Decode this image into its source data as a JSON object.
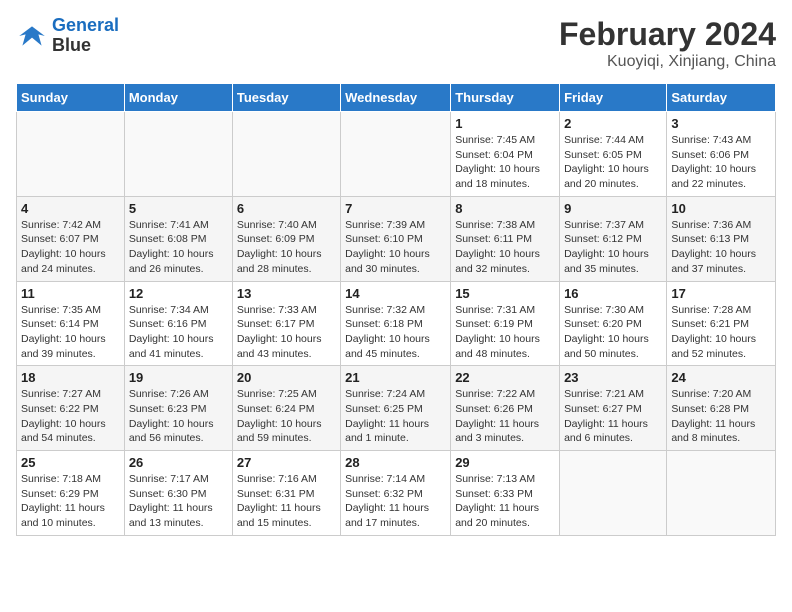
{
  "app": {
    "logo_line1": "General",
    "logo_line2": "Blue"
  },
  "title": "February 2024",
  "subtitle": "Kuoyiqi, Xinjiang, China",
  "weekdays": [
    "Sunday",
    "Monday",
    "Tuesday",
    "Wednesday",
    "Thursday",
    "Friday",
    "Saturday"
  ],
  "weeks": [
    [
      {
        "day": "",
        "info": ""
      },
      {
        "day": "",
        "info": ""
      },
      {
        "day": "",
        "info": ""
      },
      {
        "day": "",
        "info": ""
      },
      {
        "day": "1",
        "info": "Sunrise: 7:45 AM\nSunset: 6:04 PM\nDaylight: 10 hours\nand 18 minutes."
      },
      {
        "day": "2",
        "info": "Sunrise: 7:44 AM\nSunset: 6:05 PM\nDaylight: 10 hours\nand 20 minutes."
      },
      {
        "day": "3",
        "info": "Sunrise: 7:43 AM\nSunset: 6:06 PM\nDaylight: 10 hours\nand 22 minutes."
      }
    ],
    [
      {
        "day": "4",
        "info": "Sunrise: 7:42 AM\nSunset: 6:07 PM\nDaylight: 10 hours\nand 24 minutes."
      },
      {
        "day": "5",
        "info": "Sunrise: 7:41 AM\nSunset: 6:08 PM\nDaylight: 10 hours\nand 26 minutes."
      },
      {
        "day": "6",
        "info": "Sunrise: 7:40 AM\nSunset: 6:09 PM\nDaylight: 10 hours\nand 28 minutes."
      },
      {
        "day": "7",
        "info": "Sunrise: 7:39 AM\nSunset: 6:10 PM\nDaylight: 10 hours\nand 30 minutes."
      },
      {
        "day": "8",
        "info": "Sunrise: 7:38 AM\nSunset: 6:11 PM\nDaylight: 10 hours\nand 32 minutes."
      },
      {
        "day": "9",
        "info": "Sunrise: 7:37 AM\nSunset: 6:12 PM\nDaylight: 10 hours\nand 35 minutes."
      },
      {
        "day": "10",
        "info": "Sunrise: 7:36 AM\nSunset: 6:13 PM\nDaylight: 10 hours\nand 37 minutes."
      }
    ],
    [
      {
        "day": "11",
        "info": "Sunrise: 7:35 AM\nSunset: 6:14 PM\nDaylight: 10 hours\nand 39 minutes."
      },
      {
        "day": "12",
        "info": "Sunrise: 7:34 AM\nSunset: 6:16 PM\nDaylight: 10 hours\nand 41 minutes."
      },
      {
        "day": "13",
        "info": "Sunrise: 7:33 AM\nSunset: 6:17 PM\nDaylight: 10 hours\nand 43 minutes."
      },
      {
        "day": "14",
        "info": "Sunrise: 7:32 AM\nSunset: 6:18 PM\nDaylight: 10 hours\nand 45 minutes."
      },
      {
        "day": "15",
        "info": "Sunrise: 7:31 AM\nSunset: 6:19 PM\nDaylight: 10 hours\nand 48 minutes."
      },
      {
        "day": "16",
        "info": "Sunrise: 7:30 AM\nSunset: 6:20 PM\nDaylight: 10 hours\nand 50 minutes."
      },
      {
        "day": "17",
        "info": "Sunrise: 7:28 AM\nSunset: 6:21 PM\nDaylight: 10 hours\nand 52 minutes."
      }
    ],
    [
      {
        "day": "18",
        "info": "Sunrise: 7:27 AM\nSunset: 6:22 PM\nDaylight: 10 hours\nand 54 minutes."
      },
      {
        "day": "19",
        "info": "Sunrise: 7:26 AM\nSunset: 6:23 PM\nDaylight: 10 hours\nand 56 minutes."
      },
      {
        "day": "20",
        "info": "Sunrise: 7:25 AM\nSunset: 6:24 PM\nDaylight: 10 hours\nand 59 minutes."
      },
      {
        "day": "21",
        "info": "Sunrise: 7:24 AM\nSunset: 6:25 PM\nDaylight: 11 hours\nand 1 minute."
      },
      {
        "day": "22",
        "info": "Sunrise: 7:22 AM\nSunset: 6:26 PM\nDaylight: 11 hours\nand 3 minutes."
      },
      {
        "day": "23",
        "info": "Sunrise: 7:21 AM\nSunset: 6:27 PM\nDaylight: 11 hours\nand 6 minutes."
      },
      {
        "day": "24",
        "info": "Sunrise: 7:20 AM\nSunset: 6:28 PM\nDaylight: 11 hours\nand 8 minutes."
      }
    ],
    [
      {
        "day": "25",
        "info": "Sunrise: 7:18 AM\nSunset: 6:29 PM\nDaylight: 11 hours\nand 10 minutes."
      },
      {
        "day": "26",
        "info": "Sunrise: 7:17 AM\nSunset: 6:30 PM\nDaylight: 11 hours\nand 13 minutes."
      },
      {
        "day": "27",
        "info": "Sunrise: 7:16 AM\nSunset: 6:31 PM\nDaylight: 11 hours\nand 15 minutes."
      },
      {
        "day": "28",
        "info": "Sunrise: 7:14 AM\nSunset: 6:32 PM\nDaylight: 11 hours\nand 17 minutes."
      },
      {
        "day": "29",
        "info": "Sunrise: 7:13 AM\nSunset: 6:33 PM\nDaylight: 11 hours\nand 20 minutes."
      },
      {
        "day": "",
        "info": ""
      },
      {
        "day": "",
        "info": ""
      }
    ]
  ]
}
